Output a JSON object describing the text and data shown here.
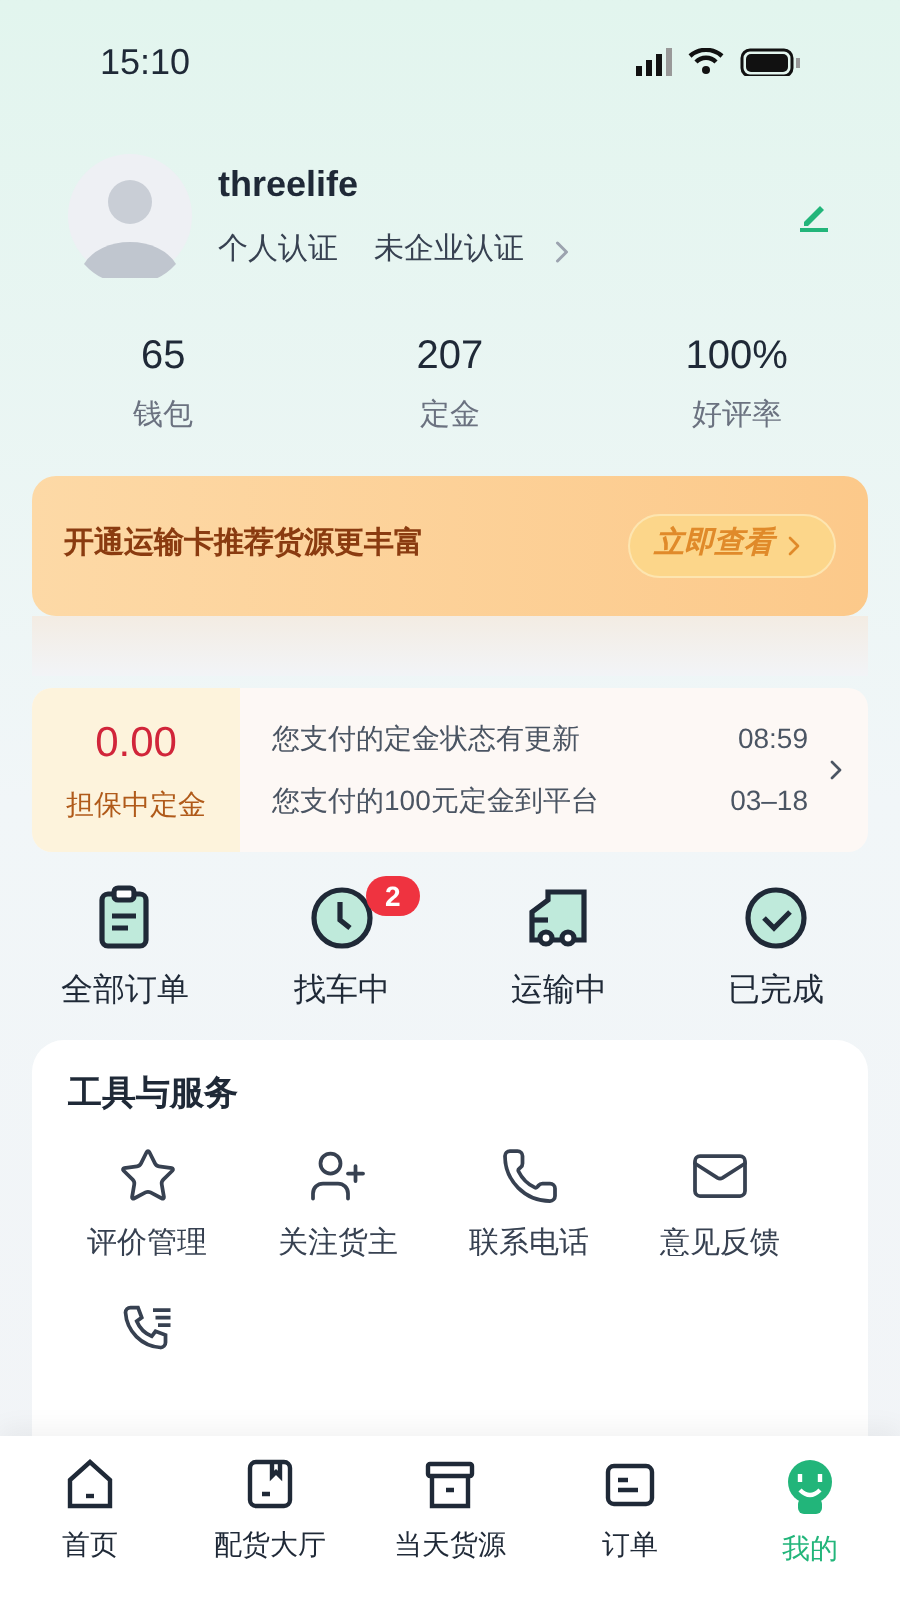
{
  "status_bar": {
    "time": "15:10"
  },
  "profile": {
    "name": "threelife",
    "certifications": [
      "个人认证",
      "未企业认证"
    ]
  },
  "stats": [
    {
      "value": "65",
      "label": "钱包"
    },
    {
      "value": "207",
      "label": "定金"
    },
    {
      "value": "100%",
      "label": "好评率"
    }
  ],
  "banner": {
    "text": "开通运输卡推荐货源更丰富",
    "button": "立即查看"
  },
  "deposit": {
    "amount": "0.00",
    "label": "担保中定金",
    "messages": [
      {
        "text": "您支付的定金状态有更新",
        "time": "08:59"
      },
      {
        "text": "您支付的100元定金到平台",
        "time": "03–18"
      }
    ]
  },
  "orders": [
    {
      "kind": "clipboard",
      "label": "全部订单"
    },
    {
      "kind": "clock",
      "label": "找车中",
      "badge": "2"
    },
    {
      "kind": "truck",
      "label": "运输中"
    },
    {
      "kind": "check",
      "label": "已完成"
    }
  ],
  "tools": {
    "title": "工具与服务",
    "items": [
      {
        "kind": "star",
        "label": "评价管理"
      },
      {
        "kind": "user-plus",
        "label": "关注货主"
      },
      {
        "kind": "phone",
        "label": "联系电话"
      },
      {
        "kind": "mail",
        "label": "意见反馈"
      },
      {
        "kind": "call-log"
      }
    ]
  },
  "tab_bar": [
    {
      "kind": "home",
      "label": "首页",
      "selected": false
    },
    {
      "kind": "package",
      "label": "配货大厅",
      "selected": false
    },
    {
      "kind": "archive",
      "label": "当天货源",
      "selected": false
    },
    {
      "kind": "order",
      "label": "订单",
      "selected": false
    },
    {
      "kind": "me",
      "label": "我的",
      "selected": true
    }
  ]
}
